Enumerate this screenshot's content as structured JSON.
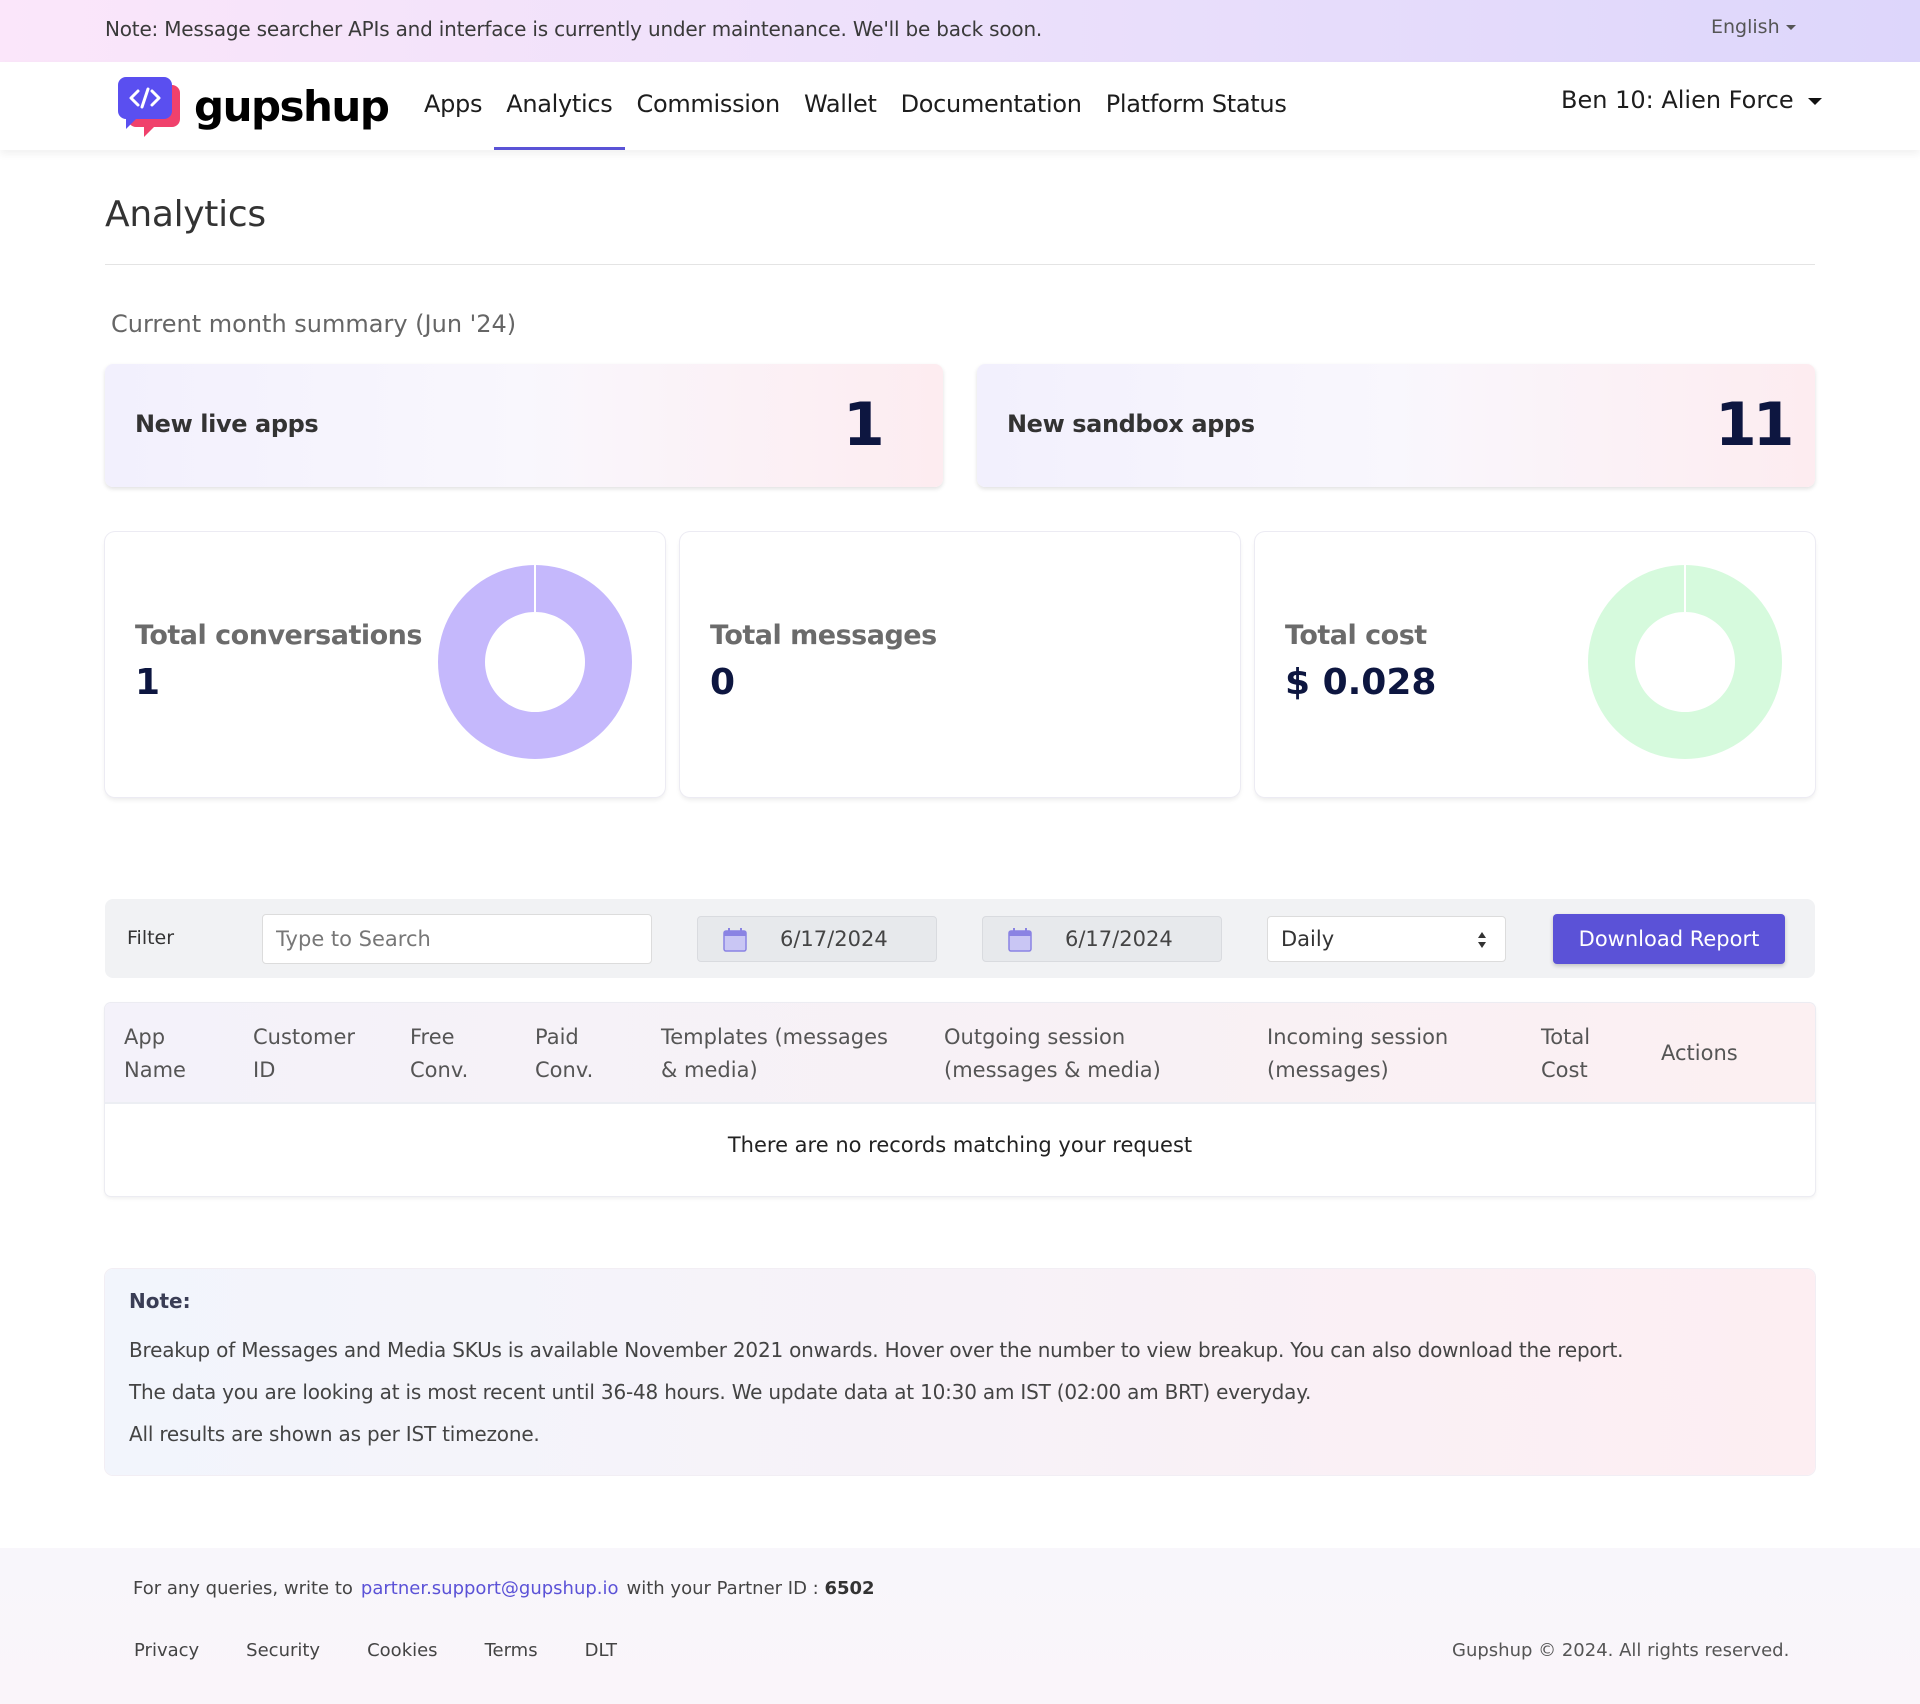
{
  "banner": {
    "notice": "Note: Message searcher APIs and interface is currently under maintenance. We'll be back soon.",
    "language": "English"
  },
  "navbar": {
    "brand": "gupshup",
    "items": [
      {
        "label": "Apps",
        "active": false
      },
      {
        "label": "Analytics",
        "active": true
      },
      {
        "label": "Commission",
        "active": false
      },
      {
        "label": "Wallet",
        "active": false
      },
      {
        "label": "Documentation",
        "active": false
      },
      {
        "label": "Platform Status",
        "active": false
      }
    ],
    "account": "Ben 10: Alien Force"
  },
  "page": {
    "title": "Analytics",
    "summary_label": "Current month summary (Jun '24)"
  },
  "summary_cards": [
    {
      "label": "New live apps",
      "value": "1"
    },
    {
      "label": "New sandbox apps",
      "value": "11"
    }
  ],
  "stat_cards": [
    {
      "label": "Total conversations",
      "value": "1",
      "donut_color": "#c5b8fc",
      "donut_fraction": 1.0
    },
    {
      "label": "Total messages",
      "value": "0"
    },
    {
      "label": "Total cost",
      "value": "$ 0.028",
      "donut_color": "#d6fadd",
      "donut_fraction": 1.0
    }
  ],
  "filter": {
    "label": "Filter",
    "search_placeholder": "Type to Search",
    "search_value": "",
    "start_date": "6/17/2024",
    "end_date": "6/17/2024",
    "granularity": "Daily",
    "download_label": "Download Report",
    "accent": "#5b52d7"
  },
  "table": {
    "columns": [
      [
        "App",
        "Name"
      ],
      [
        "Customer",
        "ID"
      ],
      [
        "Free",
        "Conv."
      ],
      [
        "Paid",
        "Conv."
      ],
      [
        "Templates (messages",
        "& media)"
      ],
      [
        "Outgoing session",
        "(messages & media)"
      ],
      [
        "Incoming session",
        "(messages)"
      ],
      [
        "Total",
        "Cost"
      ],
      [
        "Actions"
      ]
    ],
    "rows": [],
    "empty_message": "There are no records matching your request"
  },
  "note": {
    "title": "Note:",
    "lines": [
      "Breakup of Messages and Media SKUs is available November 2021 onwards. Hover over the number to view breakup. You can also download the report.",
      "The data you are looking at is most recent until 36-48 hours. We update data at 10:30 am IST (02:00 am BRT) everyday.",
      "All results are shown as per IST timezone."
    ]
  },
  "footer": {
    "query_prefix": "For any queries, write to",
    "email": "partner.support@gupshup.io",
    "query_suffix": "with your Partner ID :",
    "partner_id": "6502",
    "links": [
      "Privacy",
      "Security",
      "Cookies",
      "Terms",
      "DLT"
    ],
    "copyright": "Gupshup © 2024. All rights reserved."
  }
}
